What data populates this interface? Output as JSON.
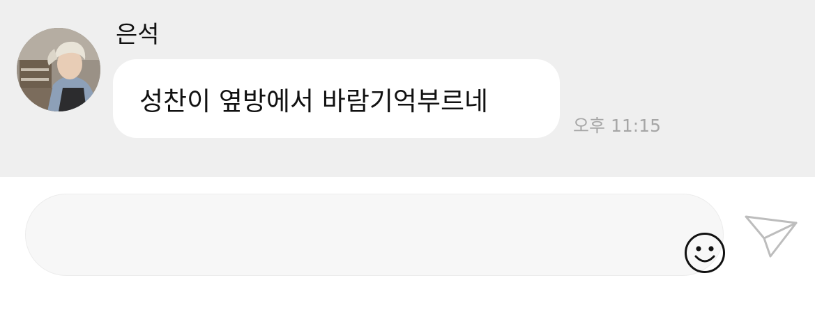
{
  "message": {
    "sender_name": "은석",
    "avatar_icon": "profile-photo-avatar",
    "text": "성찬이 옆방에서 바람기억부르네",
    "timestamp": "오후 11:15"
  },
  "composer": {
    "input_value": "",
    "input_placeholder": "",
    "emoji_icon": "smiley-face-icon",
    "send_icon": "paper-plane-send-icon"
  },
  "colors": {
    "chat_background": "#efefef",
    "bubble_background": "#ffffff",
    "timestamp_color": "#a6a6a6",
    "composer_background": "#ffffff",
    "input_background": "#f7f7f7"
  }
}
